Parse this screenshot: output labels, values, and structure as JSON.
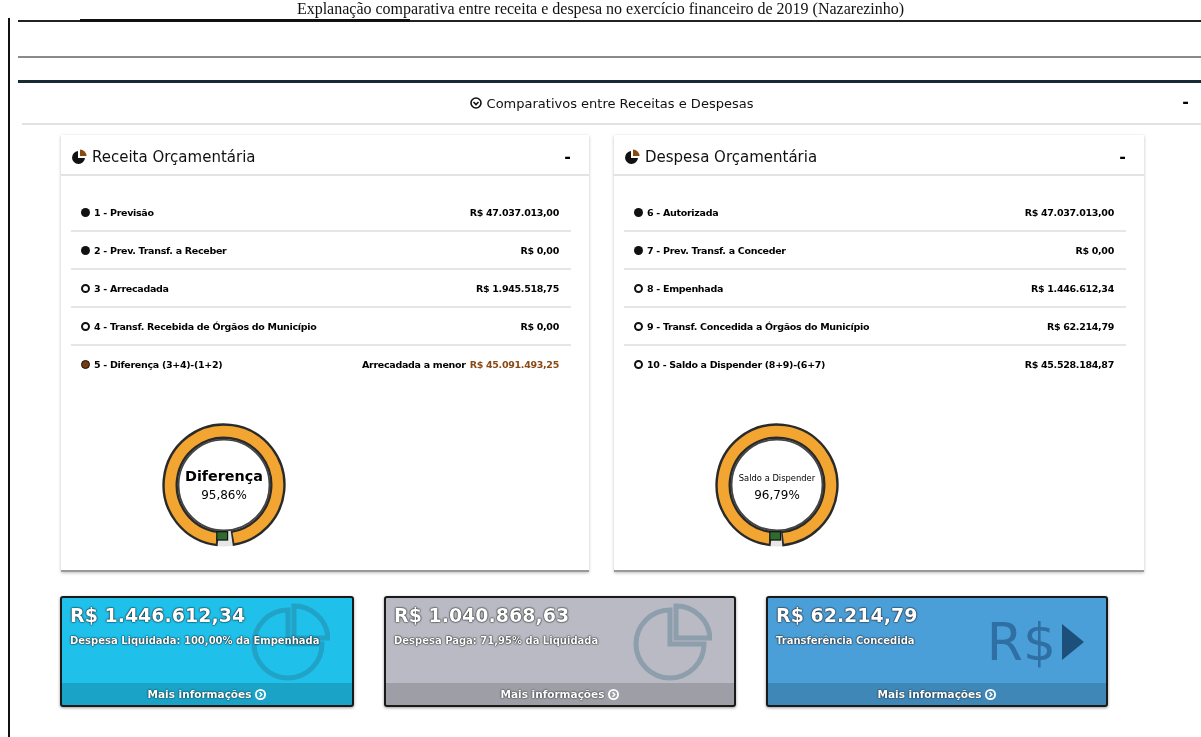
{
  "caption": "Explanação comparativa entre receita e despesa no exercício financeiro de 2019 (Nazarezinho)",
  "panel": {
    "title": "Comparativos entre Receitas e Despesas",
    "collapse": "-"
  },
  "cards": [
    {
      "title": "Receita Orçamentária",
      "collapse": "-",
      "rows": [
        {
          "kind": "filled",
          "label": "1 - Previsão",
          "value": "R$ 47.037.013,00"
        },
        {
          "kind": "filled",
          "label": "2 - Prev. Transf. a Receber",
          "value": "R$ 0,00"
        },
        {
          "kind": "open",
          "label": "3 - Arrecadada",
          "value": "R$ 1.945.518,75"
        },
        {
          "kind": "open",
          "label": "4 - Transf. Recebida de Órgãos do Município",
          "value": "R$ 0,00"
        },
        {
          "kind": "highlight",
          "label": "5 - Diferença (3+4)-(1+2)",
          "note": "Arrecadada a menor",
          "value": "R$ 45.091.493,25"
        }
      ],
      "gauge": {
        "label": "Diferença",
        "reading": "95,86%",
        "level": 0.9586
      }
    },
    {
      "title": "Despesa Orçamentária",
      "collapse": "-",
      "rows": [
        {
          "kind": "filled",
          "label": "6 - Autorizada",
          "value": "R$ 47.037.013,00"
        },
        {
          "kind": "filled",
          "label": "7 - Prev. Transf. a Conceder",
          "value": "R$ 0,00"
        },
        {
          "kind": "open",
          "label": "8 - Empenhada",
          "value": "R$ 1.446.612,34"
        },
        {
          "kind": "open",
          "label": "9 - Transf. Concedida a Órgãos do Município",
          "value": "R$ 62.214,79"
        },
        {
          "kind": "open",
          "label": "10 - Saldo a Dispender (8+9)-(6+7)",
          "value": "R$ 45.528.184,87"
        }
      ],
      "gauge": {
        "label": "Saldo a Dispender",
        "reading": "96,79%",
        "level": 0.9679
      }
    }
  ],
  "info_boxes": [
    {
      "kind": "pie",
      "color": "#1fc0ea",
      "amount": "R$ 1.446.612,34",
      "description": "Despesa Liquidada: 100,00% da Empenhada",
      "link": "Mais informações"
    },
    {
      "kind": "pie",
      "color": "#b9bac3",
      "amount": "R$ 1.040.868,63",
      "description": "Despesa Paga: 71,95% da Liquidada",
      "link": "Mais informações"
    },
    {
      "kind": "currency",
      "color": "#4b9fd8",
      "amount": "R$ 62.214,79",
      "description": "Transferência Concedida",
      "watermark": "R$",
      "link": "Mais informações"
    }
  ]
}
